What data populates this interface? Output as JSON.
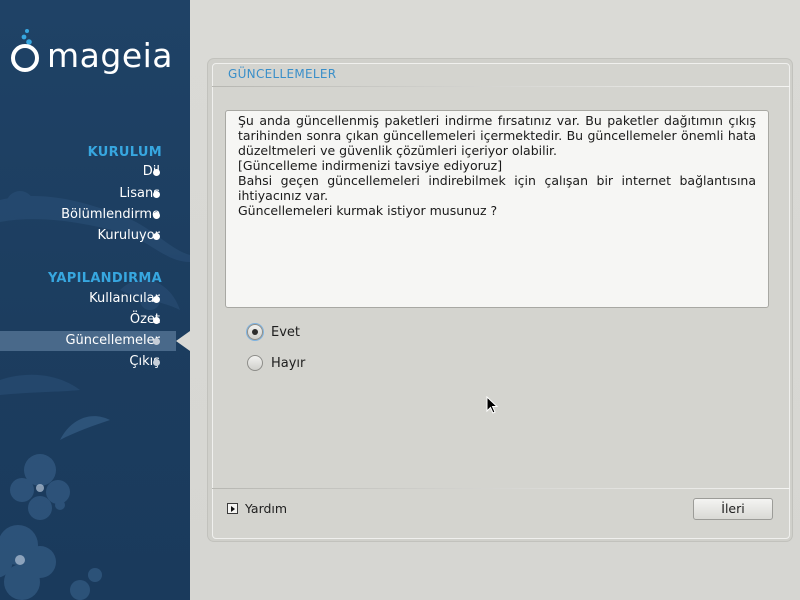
{
  "logo": {
    "text": "mageia"
  },
  "sidebar": {
    "sections": [
      {
        "title": "KURULUM",
        "steps": [
          {
            "label": "Dil",
            "state": "done"
          },
          {
            "label": "Lisans",
            "state": "done"
          },
          {
            "label": "Bölümlendirme",
            "state": "done"
          },
          {
            "label": "Kuruluyor",
            "state": "done"
          }
        ]
      },
      {
        "title": "YAPILANDIRMA",
        "steps": [
          {
            "label": "Kullanıcılar",
            "state": "done"
          },
          {
            "label": "Özet",
            "state": "done"
          },
          {
            "label": "Güncellemeler",
            "state": "active"
          },
          {
            "label": "Çıkış",
            "state": "future"
          }
        ]
      }
    ],
    "colors": {
      "background": "#1f4266",
      "section_title": "#37a7e0",
      "active_row": "#49698a"
    }
  },
  "panel": {
    "title": "GÜNCELLEMELER",
    "message": {
      "paragraph1": "Şu anda güncellenmiş paketleri indirme fırsatınız var. Bu paketler dağıtımın çıkış tarihinden sonra çıkan güncellemeleri içermektedir. Bu güncellemeler önemli hata düzeltmeleri ve güvenlik çözümleri içeriyor olabilir.",
      "line2": "[Güncelleme indirmenizi tavsiye ediyoruz]",
      "paragraph3": "Bahsi geçen güncellemeleri indirebilmek için çalışan bir internet bağlantısına ihtiyacınız var.",
      "line4": "Güncellemeleri kurmak istiyor musunuz ?"
    },
    "options": [
      {
        "label": "Evet",
        "checked": true
      },
      {
        "label": "Hayır",
        "checked": false
      }
    ],
    "help_label": "Yardım",
    "next_label": "İleri"
  },
  "colors": {
    "panel_title": "#3a8fc9",
    "main_background": "#d9d9d5"
  }
}
